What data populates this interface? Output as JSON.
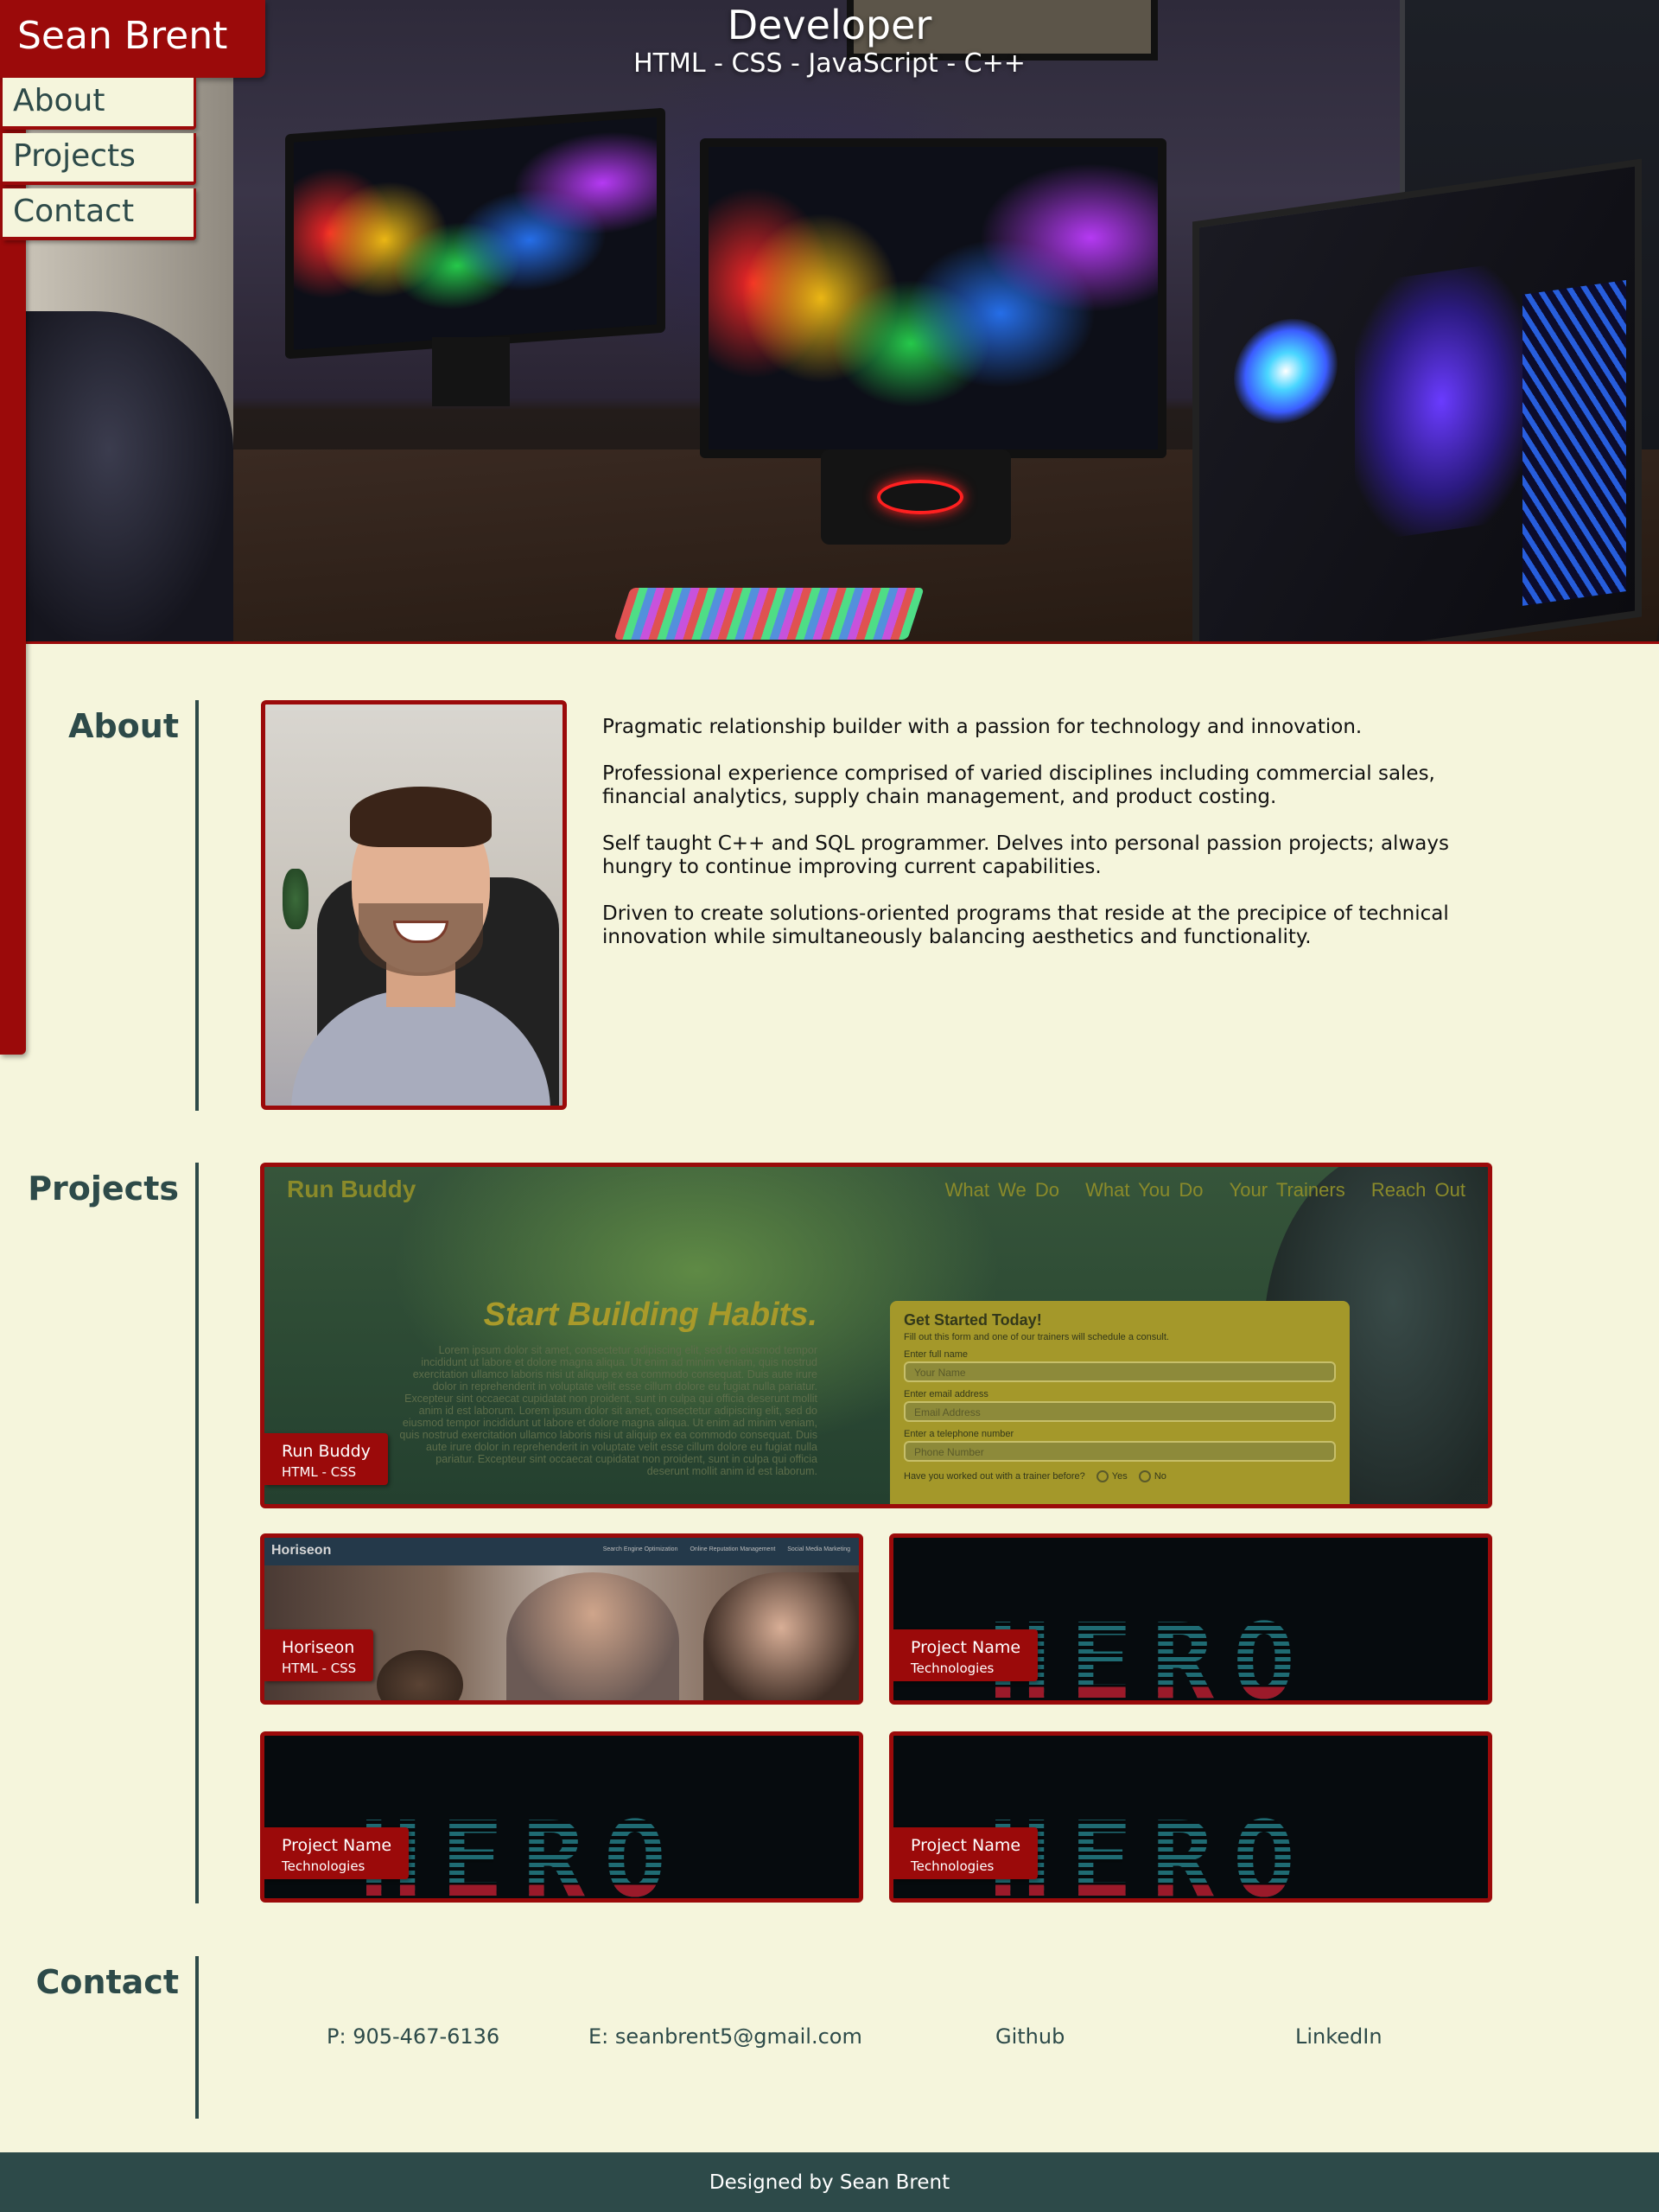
{
  "sidebar": {
    "brand": "Sean Brent",
    "nav": [
      {
        "label": "About"
      },
      {
        "label": "Projects"
      },
      {
        "label": "Contact"
      }
    ]
  },
  "hero": {
    "title": "Developer",
    "subtitle": "HTML - CSS - JavaScript - C++"
  },
  "about": {
    "heading": "About",
    "paragraphs": [
      "Pragmatic relationship builder with a passion for technology and innovation.",
      "Professional experience comprised of varied disciplines including commercial sales, financial analytics, supply chain management, and product costing.",
      "Self taught C++ and SQL programmer. Delves into personal passion projects; always hungry to continue improving current capabilities.",
      "Driven to create solutions-oriented programs that reside at the precipice of technical innovation while simultaneously balancing aesthetics and functionality."
    ]
  },
  "projects": {
    "heading": "Projects",
    "run_buddy": {
      "name": "Run Buddy",
      "tech": "HTML - CSS",
      "preview": {
        "brand": "Run Buddy",
        "nav": [
          "What We Do",
          "What You Do",
          "Your Trainers",
          "Reach Out"
        ],
        "headline": "Start Building Habits.",
        "lorem": "Lorem ipsum dolor sit amet, consectetur adipiscing elit, sed do eiusmod tempor incididunt ut labore et dolore magna aliqua. Ut enim ad minim veniam, quis nostrud exercitation ullamco laboris nisi ut aliquip ex ea commodo consequat. Duis aute irure dolor in reprehenderit in voluptate velit esse cillum dolore eu fugiat nulla pariatur. Excepteur sint occaecat cupidatat non proident, sunt in culpa qui officia deserunt mollit anim id est laborum. Lorem ipsum dolor sit amet, consectetur adipiscing elit, sed do eiusmod tempor incididunt ut labore et dolore magna aliqua. Ut enim ad minim veniam, quis nostrud exercitation ullamco laboris nisi ut aliquip ex ea commodo consequat. Duis aute irure dolor in reprehenderit in voluptate velit esse cillum dolore eu fugiat nulla pariatur. Excepteur sint occaecat cupidatat non proident, sunt in culpa qui officia deserunt mollit anim id est laborum.",
        "form": {
          "title": "Get Started Today!",
          "subtitle": "Fill out this form and one of our trainers will schedule a consult.",
          "name_label": "Enter full name",
          "name_placeholder": "Your Name",
          "email_label": "Enter email address",
          "email_placeholder": "Email Address",
          "phone_label": "Enter a telephone number",
          "phone_placeholder": "Phone Number",
          "question": "Have you worked out with a trainer before?",
          "yes": "Yes",
          "no": "No"
        }
      }
    },
    "horiseon": {
      "name": "Horiseon",
      "tech": "HTML - CSS",
      "preview": {
        "brand": "Horiseon",
        "links": [
          "Search Engine Optimization",
          "Online Reputation Management",
          "Social Media Marketing"
        ]
      }
    },
    "placeholder": {
      "name": "Project Name",
      "tech": "Technologies",
      "image_text": "HERO"
    }
  },
  "contact": {
    "heading": "Contact",
    "phone": "P: 905-467-6136",
    "email": "E: seanbrent5@gmail.com",
    "github": "Github",
    "linkedin": "LinkedIn"
  },
  "footer": {
    "text": "Designed by Sean Brent"
  },
  "colors": {
    "accent": "#9b0a0a",
    "background": "#f5f5dc",
    "text": "#2d4a49"
  }
}
